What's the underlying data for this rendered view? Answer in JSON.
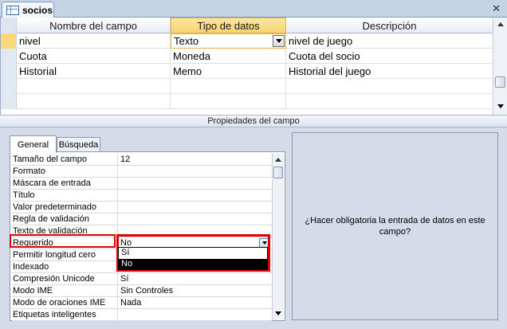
{
  "tab": {
    "label": "socios",
    "icon": "table-icon"
  },
  "grid": {
    "columns": [
      "Nombre del campo",
      "Tipo de datos",
      "Descripción"
    ],
    "rows": [
      {
        "name": "nivel",
        "type": "Texto",
        "description": "nivel de juego"
      },
      {
        "name": "Cuota",
        "type": "Moneda",
        "description": "Cuota del socio"
      },
      {
        "name": "Historial",
        "type": "Memo",
        "description": "Historial del juego"
      }
    ]
  },
  "properties": {
    "title": "Propiedades del campo",
    "tabs": [
      "General",
      "Búsqueda"
    ],
    "rows": [
      {
        "label": "Tamaño del campo",
        "value": "12"
      },
      {
        "label": "Formato",
        "value": ""
      },
      {
        "label": "Máscara de entrada",
        "value": ""
      },
      {
        "label": "Título",
        "value": ""
      },
      {
        "label": "Valor predeterminado",
        "value": ""
      },
      {
        "label": "Regla de validación",
        "value": ""
      },
      {
        "label": "Texto de validación",
        "value": ""
      },
      {
        "label": "Requerido",
        "value": "No"
      },
      {
        "label": "Permitir longitud cero",
        "value": ""
      },
      {
        "label": "Indexado",
        "value": ""
      },
      {
        "label": "Compresión Unicode",
        "value": "Sí"
      },
      {
        "label": "Modo IME",
        "value": "Sin Controles"
      },
      {
        "label": "Modo de oraciones IME",
        "value": "Nada"
      },
      {
        "label": "Etiquetas inteligentes",
        "value": ""
      }
    ],
    "dropdown_options": [
      "Sí",
      "No"
    ],
    "dropdown_selected": "No"
  },
  "help_text": "¿Hacer obligatoria la entrada de datos en este campo?",
  "colors": {
    "highlight_red": "#e00000",
    "selected_header": "#f7d36f"
  }
}
